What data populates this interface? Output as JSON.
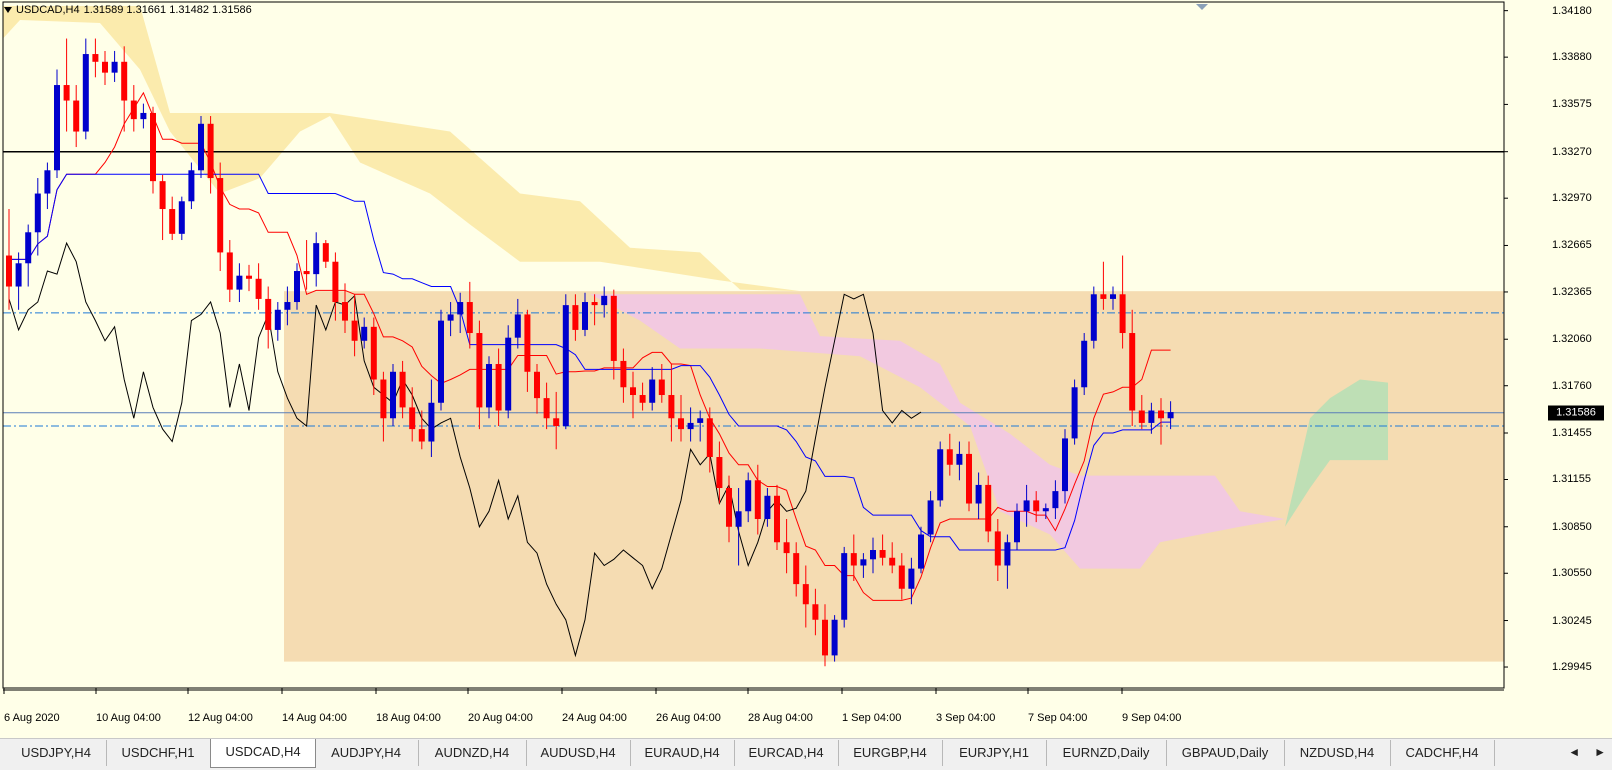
{
  "header": {
    "symbol": "USDCAD,H4",
    "ohlc": "1.31589 1.31661 1.31482 1.31586"
  },
  "price_axis": {
    "labels": [
      "1.34180",
      "1.33880",
      "1.33575",
      "1.33270",
      "1.32970",
      "1.32665",
      "1.32365",
      "1.32060",
      "1.31760",
      "1.31455",
      "1.31155",
      "1.30850",
      "1.30550",
      "1.30245",
      "1.29945"
    ],
    "current_price": "1.31586"
  },
  "time_axis": {
    "labels": [
      "6 Aug 2020",
      "10 Aug 04:00",
      "12 Aug 04:00",
      "14 Aug 04:00",
      "18 Aug 04:00",
      "20 Aug 04:00",
      "24 Aug 04:00",
      "26 Aug 04:00",
      "28 Aug 04:00",
      "1 Sep 04:00",
      "3 Sep 04:00",
      "7 Sep 04:00",
      "9 Sep 04:00"
    ]
  },
  "tabs": [
    {
      "label": "USDJPY,H4",
      "active": false
    },
    {
      "label": "USDCHF,H1",
      "active": false
    },
    {
      "label": "USDCAD,H4",
      "active": true
    },
    {
      "label": "AUDJPY,H4",
      "active": false
    },
    {
      "label": "AUDNZD,H4",
      "active": false
    },
    {
      "label": "AUDUSD,H4",
      "active": false
    },
    {
      "label": "EURAUD,H4",
      "active": false
    },
    {
      "label": "EURCAD,H4",
      "active": false
    },
    {
      "label": "EURGBP,H4",
      "active": false
    },
    {
      "label": "EURJPY,H1",
      "active": false
    },
    {
      "label": "EURNZD,Daily",
      "active": false
    },
    {
      "label": "GBPAUD,Daily",
      "active": false
    },
    {
      "label": "NZDUSD,H4",
      "active": false
    },
    {
      "label": "CADCHF,H4",
      "active": false
    }
  ],
  "tab_scroll": {
    "left": "◄",
    "right": "►"
  },
  "colors": {
    "background": "#ffffe8",
    "bull_candle": "#0000cc",
    "bear_candle": "#ff0000",
    "tenkan": "#ff0000",
    "kijun": "#0000ff",
    "chikou": "#000000",
    "kumo_bear": "#fbe9a6",
    "kumo_bull": "#f2c7e4",
    "rectangle": "#f5dcb2"
  },
  "chart_data": {
    "type": "candlestick",
    "indicator": "Ichimoku Kinko Hyo",
    "ylim": [
      1.299,
      1.3421
    ],
    "horizontal_lines": [
      1.3327,
      1.3223,
      1.31586,
      1.315
    ],
    "candles": [
      [
        1.326,
        1.329,
        1.3225,
        1.324
      ],
      [
        1.324,
        1.3262,
        1.3225,
        1.3255
      ],
      [
        1.3255,
        1.328,
        1.324,
        1.3275
      ],
      [
        1.3275,
        1.331,
        1.326,
        1.33
      ],
      [
        1.33,
        1.332,
        1.329,
        1.3315
      ],
      [
        1.3315,
        1.338,
        1.331,
        1.337
      ],
      [
        1.337,
        1.34,
        1.334,
        1.336
      ],
      [
        1.336,
        1.337,
        1.333,
        1.334
      ],
      [
        1.334,
        1.34,
        1.3335,
        1.339
      ],
      [
        1.339,
        1.34,
        1.3375,
        1.3385
      ],
      [
        1.3385,
        1.3392,
        1.337,
        1.3378
      ],
      [
        1.3378,
        1.3392,
        1.3372,
        1.3385
      ],
      [
        1.3385,
        1.3395,
        1.334,
        1.336
      ],
      [
        1.336,
        1.337,
        1.334,
        1.3348
      ],
      [
        1.3348,
        1.3358,
        1.3342,
        1.3352
      ],
      [
        1.3352,
        1.3356,
        1.33,
        1.3308
      ],
      [
        1.3308,
        1.3312,
        1.327,
        1.329
      ],
      [
        1.329,
        1.3298,
        1.327,
        1.3274
      ],
      [
        1.3274,
        1.3298,
        1.327,
        1.3295
      ],
      [
        1.3295,
        1.332,
        1.329,
        1.3315
      ],
      [
        1.3315,
        1.335,
        1.331,
        1.3345
      ],
      [
        1.3345,
        1.335,
        1.33,
        1.331
      ],
      [
        1.331,
        1.332,
        1.325,
        1.3262
      ],
      [
        1.3262,
        1.327,
        1.323,
        1.3238
      ],
      [
        1.3238,
        1.3255,
        1.323,
        1.3247
      ],
      [
        1.3247,
        1.3254,
        1.3237,
        1.3245
      ],
      [
        1.3245,
        1.3255,
        1.3225,
        1.3232
      ],
      [
        1.3232,
        1.324,
        1.32,
        1.3212
      ],
      [
        1.3212,
        1.323,
        1.3205,
        1.3225
      ],
      [
        1.3225,
        1.324,
        1.3215,
        1.323
      ],
      [
        1.323,
        1.3255,
        1.3225,
        1.325
      ],
      [
        1.325,
        1.327,
        1.3238,
        1.3248
      ],
      [
        1.3248,
        1.3275,
        1.324,
        1.3268
      ],
      [
        1.3268,
        1.327,
        1.3252,
        1.3256
      ],
      [
        1.3256,
        1.3262,
        1.3218,
        1.323
      ],
      [
        1.323,
        1.3242,
        1.321,
        1.3218
      ],
      [
        1.3218,
        1.3235,
        1.3195,
        1.3205
      ],
      [
        1.3205,
        1.322,
        1.32,
        1.3214
      ],
      [
        1.3214,
        1.322,
        1.317,
        1.318
      ],
      [
        1.318,
        1.3185,
        1.314,
        1.3155
      ],
      [
        1.3155,
        1.319,
        1.315,
        1.3185
      ],
      [
        1.3185,
        1.3192,
        1.3155,
        1.3162
      ],
      [
        1.3162,
        1.3175,
        1.314,
        1.3148
      ],
      [
        1.3148,
        1.316,
        1.3135,
        1.314
      ],
      [
        1.314,
        1.318,
        1.313,
        1.3165
      ],
      [
        1.3165,
        1.3225,
        1.316,
        1.3218
      ],
      [
        1.3218,
        1.323,
        1.3208,
        1.3222
      ],
      [
        1.3222,
        1.3236,
        1.321,
        1.323
      ],
      [
        1.323,
        1.3243,
        1.32,
        1.321
      ],
      [
        1.321,
        1.3218,
        1.3148,
        1.3162
      ],
      [
        1.3162,
        1.3195,
        1.3155,
        1.319
      ],
      [
        1.319,
        1.32,
        1.315,
        1.316
      ],
      [
        1.316,
        1.3215,
        1.3155,
        1.3207
      ],
      [
        1.3207,
        1.3232,
        1.32,
        1.3222
      ],
      [
        1.3222,
        1.3225,
        1.3172,
        1.3185
      ],
      [
        1.3185,
        1.319,
        1.3158,
        1.3168
      ],
      [
        1.3168,
        1.3178,
        1.3148,
        1.3155
      ],
      [
        1.3155,
        1.3172,
        1.3135,
        1.315
      ],
      [
        1.315,
        1.3235,
        1.3148,
        1.3228
      ],
      [
        1.3228,
        1.3235,
        1.3205,
        1.3212
      ],
      [
        1.3212,
        1.3236,
        1.3208,
        1.323
      ],
      [
        1.323,
        1.3235,
        1.3215,
        1.3228
      ],
      [
        1.3228,
        1.324,
        1.322,
        1.3234
      ],
      [
        1.3234,
        1.3238,
        1.318,
        1.3192
      ],
      [
        1.3192,
        1.32,
        1.3165,
        1.3175
      ],
      [
        1.3175,
        1.3185,
        1.3155,
        1.317
      ],
      [
        1.317,
        1.3178,
        1.316,
        1.3165
      ],
      [
        1.3165,
        1.3188,
        1.316,
        1.318
      ],
      [
        1.318,
        1.319,
        1.3165,
        1.317
      ],
      [
        1.317,
        1.319,
        1.314,
        1.3155
      ],
      [
        1.3155,
        1.317,
        1.314,
        1.3148
      ],
      [
        1.3148,
        1.3162,
        1.314,
        1.3152
      ],
      [
        1.3152,
        1.316,
        1.314,
        1.3155
      ],
      [
        1.3155,
        1.3162,
        1.312,
        1.313
      ],
      [
        1.313,
        1.314,
        1.31,
        1.311
      ],
      [
        1.311,
        1.3118,
        1.3075,
        1.3085
      ],
      [
        1.3085,
        1.311,
        1.306,
        1.3095
      ],
      [
        1.3095,
        1.312,
        1.3088,
        1.3115
      ],
      [
        1.3115,
        1.3125,
        1.308,
        1.309
      ],
      [
        1.309,
        1.311,
        1.3085,
        1.3105
      ],
      [
        1.3105,
        1.3112,
        1.307,
        1.3075
      ],
      [
        1.3075,
        1.309,
        1.3055,
        1.3068
      ],
      [
        1.3068,
        1.3075,
        1.304,
        1.3048
      ],
      [
        1.3048,
        1.306,
        1.302,
        1.3035
      ],
      [
        1.3035,
        1.3045,
        1.3015,
        1.3025
      ],
      [
        1.3025,
        1.3035,
        1.2995,
        1.3002
      ],
      [
        1.3002,
        1.3028,
        1.2998,
        1.3025
      ],
      [
        1.3025,
        1.3072,
        1.302,
        1.3068
      ],
      [
        1.3068,
        1.308,
        1.305,
        1.306
      ],
      [
        1.306,
        1.3068,
        1.3052,
        1.3064
      ],
      [
        1.3064,
        1.3078,
        1.3055,
        1.307
      ],
      [
        1.307,
        1.308,
        1.306,
        1.3065
      ],
      [
        1.3065,
        1.3075,
        1.3055,
        1.306
      ],
      [
        1.306,
        1.3068,
        1.3038,
        1.3045
      ],
      [
        1.3045,
        1.3065,
        1.3035,
        1.3058
      ],
      [
        1.3058,
        1.3085,
        1.3055,
        1.308
      ],
      [
        1.308,
        1.3108,
        1.3075,
        1.3102
      ],
      [
        1.3102,
        1.314,
        1.3098,
        1.3135
      ],
      [
        1.3135,
        1.3145,
        1.3118,
        1.3125
      ],
      [
        1.3125,
        1.314,
        1.3115,
        1.3132
      ],
      [
        1.3132,
        1.314,
        1.3095,
        1.31
      ],
      [
        1.31,
        1.312,
        1.309,
        1.3112
      ],
      [
        1.3112,
        1.3118,
        1.3075,
        1.3082
      ],
      [
        1.3082,
        1.309,
        1.305,
        1.306
      ],
      [
        1.306,
        1.308,
        1.3045,
        1.3075
      ],
      [
        1.3075,
        1.31,
        1.307,
        1.3095
      ],
      [
        1.3095,
        1.3112,
        1.3085,
        1.3102
      ],
      [
        1.3102,
        1.3108,
        1.3088,
        1.3095
      ],
      [
        1.3095,
        1.31,
        1.309,
        1.3097
      ],
      [
        1.3097,
        1.3115,
        1.309,
        1.3108
      ],
      [
        1.3108,
        1.3148,
        1.31,
        1.3142
      ],
      [
        1.3142,
        1.318,
        1.3138,
        1.3175
      ],
      [
        1.3175,
        1.321,
        1.317,
        1.3205
      ],
      [
        1.3205,
        1.324,
        1.32,
        1.3235
      ],
      [
        1.3235,
        1.3256,
        1.3225,
        1.3232
      ],
      [
        1.3232,
        1.324,
        1.3225,
        1.3235
      ],
      [
        1.3235,
        1.326,
        1.32,
        1.321
      ],
      [
        1.321,
        1.3225,
        1.315,
        1.316
      ],
      [
        1.316,
        1.317,
        1.3148,
        1.3152
      ],
      [
        1.3152,
        1.3165,
        1.3145,
        1.316
      ],
      [
        1.316,
        1.3168,
        1.3138,
        1.3155
      ],
      [
        1.3155,
        1.3166,
        1.3148,
        1.3159
      ]
    ]
  }
}
